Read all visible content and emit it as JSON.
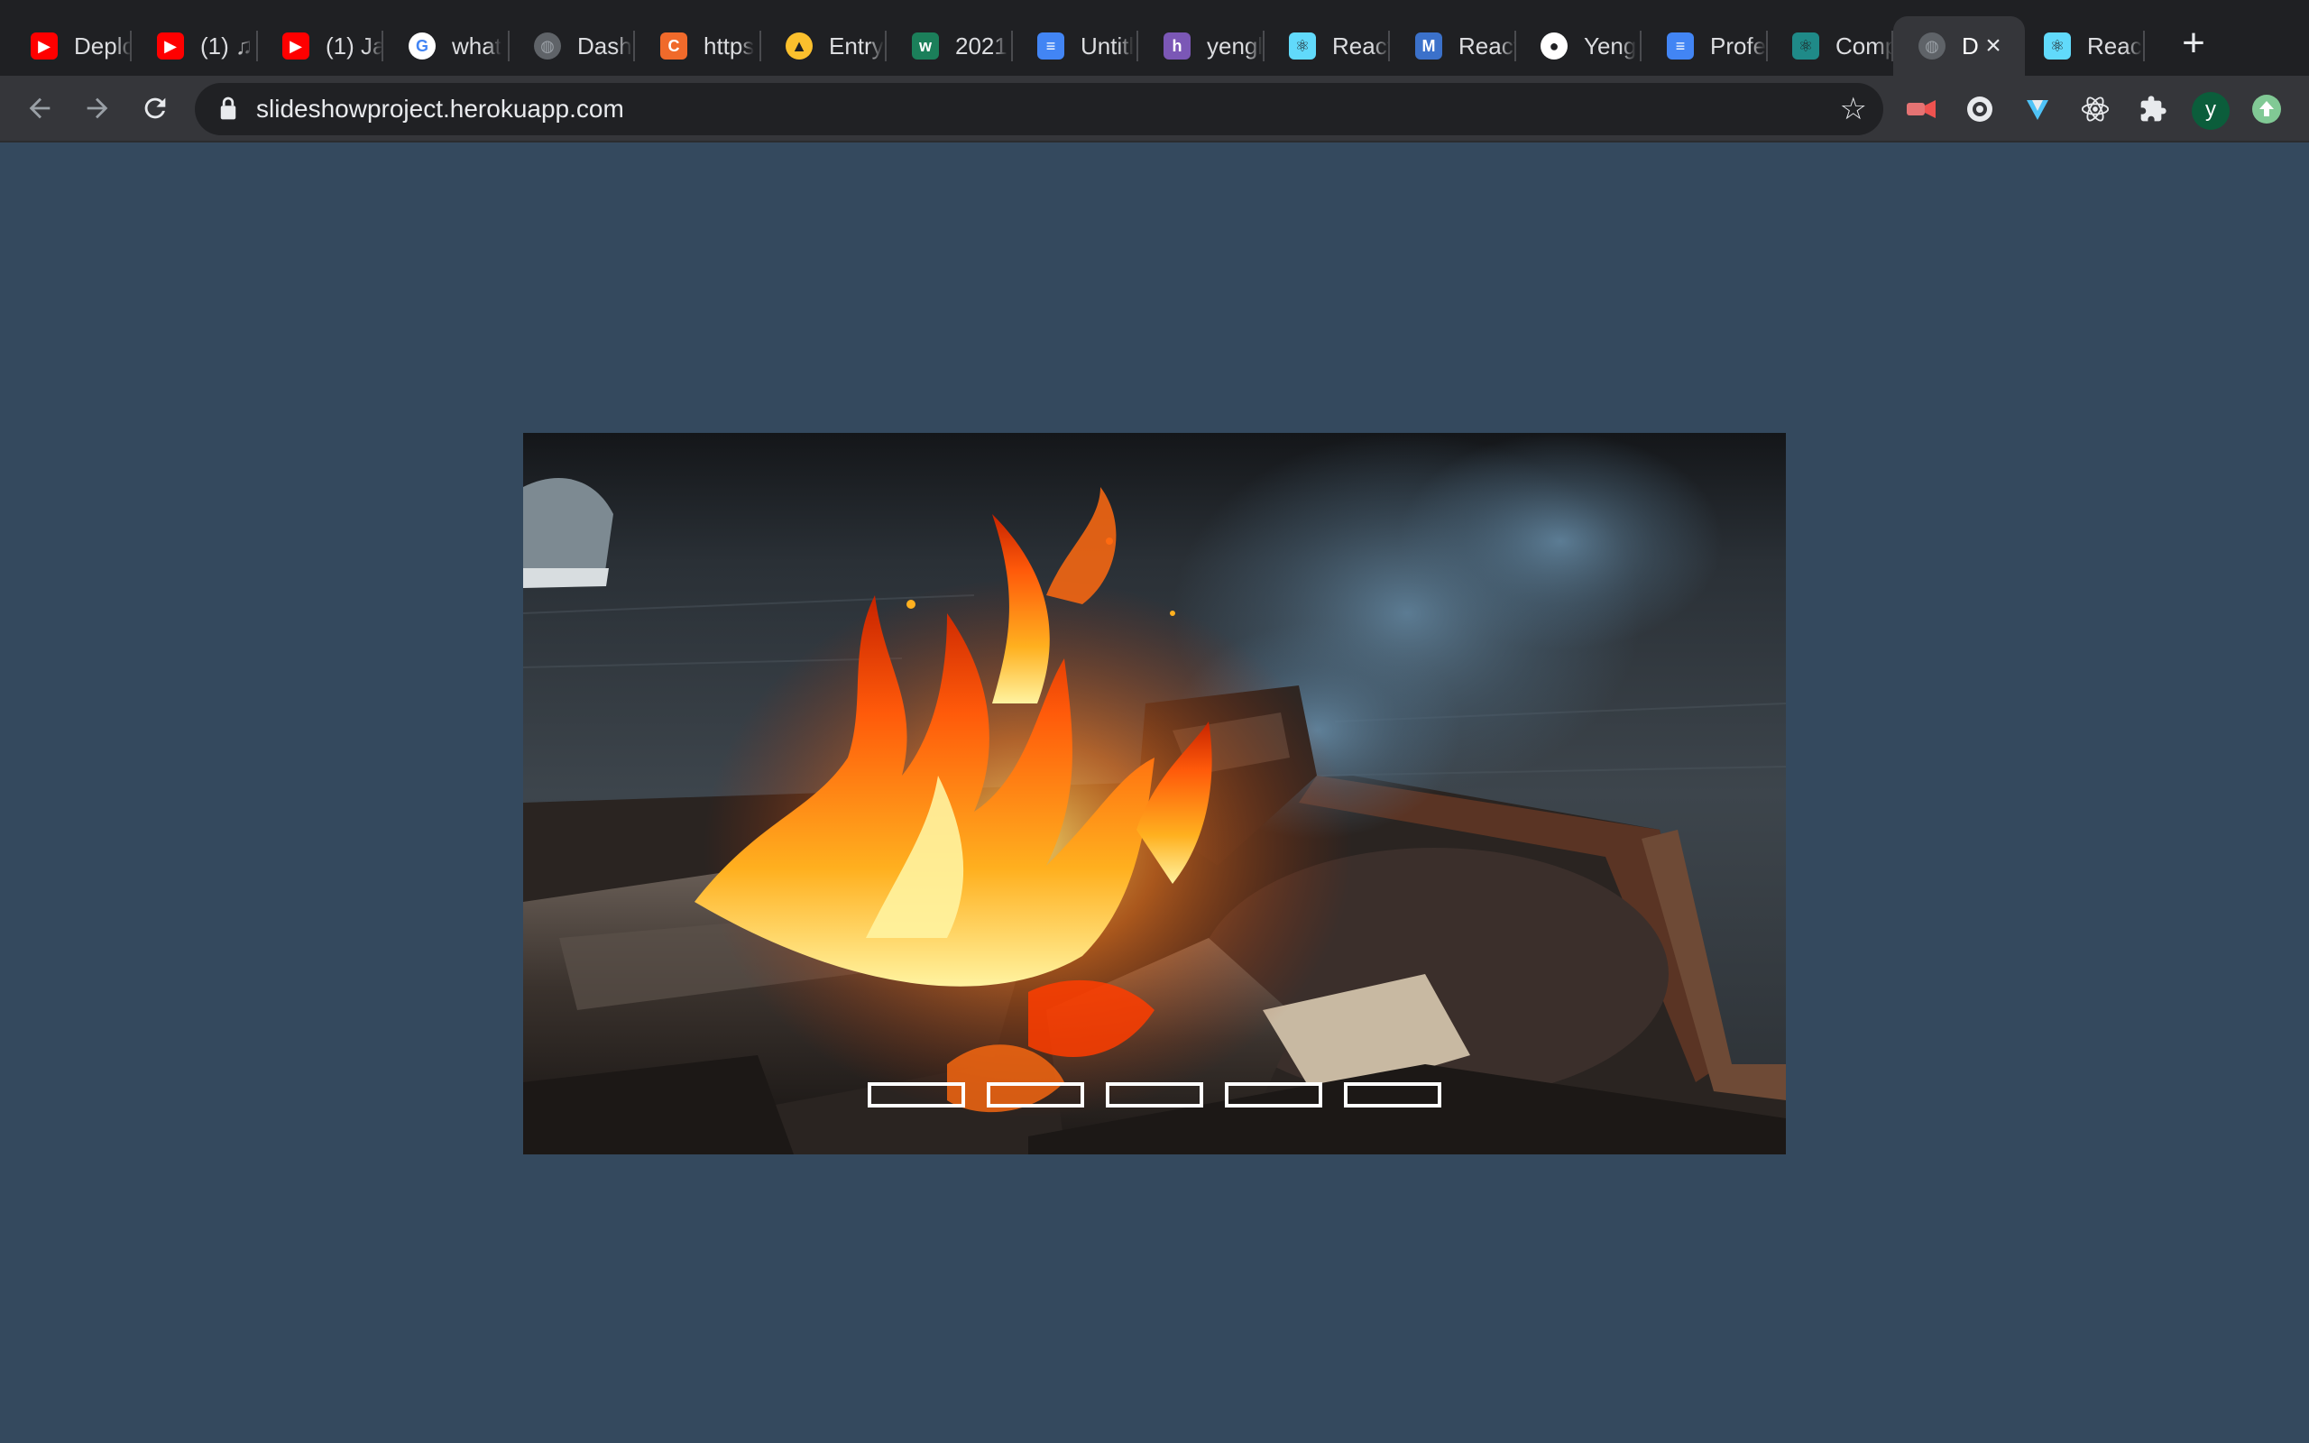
{
  "browser": {
    "tabs": [
      {
        "title": "Deplo",
        "icon": "youtube-icon",
        "color": "#ff0000"
      },
      {
        "title": "(1) ♫",
        "icon": "youtube-icon",
        "color": "#ff0000"
      },
      {
        "title": "(1) Ja",
        "icon": "youtube-icon",
        "color": "#ff0000"
      },
      {
        "title": "what",
        "icon": "google-icon",
        "color": "#ffffff"
      },
      {
        "title": "Dash",
        "icon": "globe-icon",
        "color": "#5f6368"
      },
      {
        "title": "https",
        "icon": "codecademy-icon",
        "color": "#f06a2b"
      },
      {
        "title": "Entry",
        "icon": "drive-icon",
        "color": "#fbc02d"
      },
      {
        "title": "2021",
        "icon": "upwork-icon",
        "color": "#1b7f5a"
      },
      {
        "title": "Untitl",
        "icon": "docs-icon",
        "color": "#4285f4"
      },
      {
        "title": "yengl",
        "icon": "heroku-icon",
        "color": "#7b57b6"
      },
      {
        "title": "React",
        "icon": "react-icon",
        "color": "#61dafb"
      },
      {
        "title": "React",
        "icon": "mdb-icon",
        "color": "#3b71ca"
      },
      {
        "title": "Yeng",
        "icon": "github-icon",
        "color": "#ffffff"
      },
      {
        "title": "Profe",
        "icon": "docs-icon",
        "color": "#4285f4"
      },
      {
        "title": "Comp",
        "icon": "react-icon",
        "color": "#1f8a88"
      },
      {
        "title": "D",
        "icon": "globe-icon",
        "color": "#5f6368",
        "active": true
      },
      {
        "title": "Reac",
        "icon": "react-icon",
        "color": "#61dafb"
      }
    ],
    "url": "slideshowproject.herokuapp.com",
    "avatar_letter": "y",
    "extensions": [
      "screencast-icon",
      "extension-icon",
      "devtools-icon",
      "react-devtools-icon",
      "puzzle-icon"
    ]
  },
  "slideshow": {
    "image": "campfire-photo",
    "indicator_count": 5,
    "active_indicator": 0
  }
}
